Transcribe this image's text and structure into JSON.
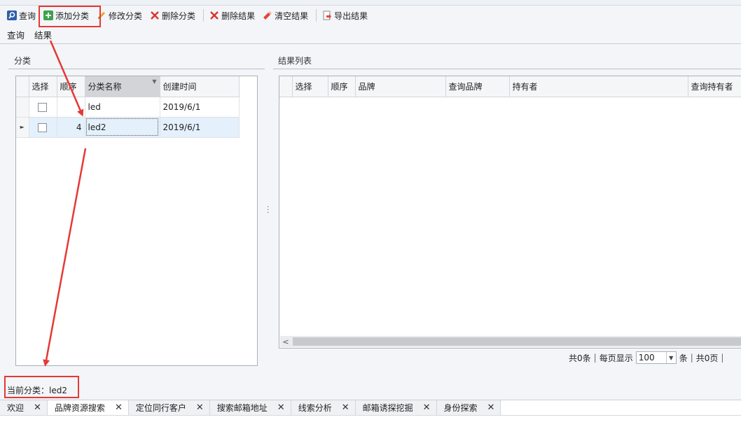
{
  "toolbar": {
    "query": "查询",
    "add_category": "添加分类",
    "edit_category": "修改分类",
    "delete_category": "删除分类",
    "delete_result": "删除结果",
    "clear_result": "清空结果",
    "export_result": "导出结果"
  },
  "menu": {
    "query": "查询",
    "result": "结果"
  },
  "category_panel": {
    "title": "分类",
    "columns": [
      "选择",
      "顺序",
      "分类名称",
      "创建时间"
    ],
    "rows": [
      {
        "checked": false,
        "order": "",
        "name": "led",
        "created": "2019/6/1"
      },
      {
        "checked": false,
        "order": "4",
        "name": "led2",
        "created": "2019/6/1"
      }
    ]
  },
  "result_panel": {
    "title": "结果列表",
    "columns": [
      "选择",
      "顺序",
      "品牌",
      "查询品牌",
      "持有者",
      "查询持有者"
    ]
  },
  "pager": {
    "total": "共0条",
    "per_page_label": "每页显示",
    "per_page_value": "100",
    "unit": "条",
    "pages": "共0页"
  },
  "current_category": "当前分类：led2",
  "tabs": [
    {
      "label": "欢迎",
      "active": false
    },
    {
      "label": "品牌资源搜索",
      "active": true
    },
    {
      "label": "定位同行客户",
      "active": false
    },
    {
      "label": "搜索邮箱地址",
      "active": false
    },
    {
      "label": "线索分析",
      "active": false
    },
    {
      "label": "邮箱诱探挖掘",
      "active": false
    },
    {
      "label": "身份探索",
      "active": false
    }
  ],
  "colors": {
    "annotation_red": "#e53935",
    "selected_row": "#e4f0fb"
  }
}
